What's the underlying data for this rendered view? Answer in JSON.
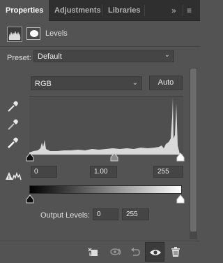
{
  "tabs": [
    {
      "label": "Properties",
      "active": true
    },
    {
      "label": "Adjustments",
      "active": false
    },
    {
      "label": "Libraries",
      "active": false
    }
  ],
  "tab_controls": {
    "expand_icon": "double-chevron-right-icon",
    "menu_icon": "hamburger-menu-icon"
  },
  "header": {
    "title": "Levels",
    "adjustment_icon": "levels-histogram-icon",
    "mask_icon": "layer-mask-icon"
  },
  "preset": {
    "label": "Preset:",
    "value": "Default"
  },
  "channel": {
    "value": "RGB"
  },
  "auto_button": "Auto",
  "eyedroppers": [
    "black-point-eyedropper-icon",
    "gray-point-eyedropper-icon",
    "white-point-eyedropper-icon"
  ],
  "input_levels": {
    "black": "0",
    "midtone": "1.00",
    "white": "255"
  },
  "output_levels": {
    "label": "Output Levels:",
    "black": "0",
    "white": "255"
  },
  "bottom_toolbar": [
    "clip-to-layer-icon",
    "view-previous-state-icon",
    "reset-icon",
    "visibility-eye-icon",
    "trash-icon"
  ],
  "colors": {
    "panel": "#535353",
    "tabbar": "#2f2f2f",
    "field": "#454545",
    "histogram": "#d8d8d8"
  }
}
